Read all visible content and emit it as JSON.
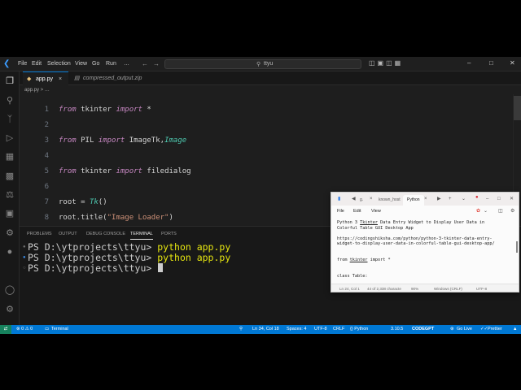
{
  "titlebar": {
    "menus": [
      "File",
      "Edit",
      "Selection",
      "View",
      "Go",
      "Run"
    ],
    "more": "…",
    "search_text": "ttyu"
  },
  "tabs": [
    {
      "label": "app.py",
      "close": "×"
    },
    {
      "label": "compressed_output.zip"
    }
  ],
  "breadcrumb": "app.py > …",
  "editor": {
    "lines": [
      {
        "n": "1",
        "parts": [
          [
            "kw it",
            "from"
          ],
          [
            "",
            " tkinter "
          ],
          [
            "kw it",
            "import"
          ],
          [
            "",
            " *"
          ]
        ]
      },
      {
        "n": "2",
        "parts": []
      },
      {
        "n": "3",
        "parts": [
          [
            "kw it",
            "from"
          ],
          [
            "",
            " PIL "
          ],
          [
            "kw it",
            "import"
          ],
          [
            "",
            " ImageTk,"
          ],
          [
            "cls it",
            "Image"
          ]
        ]
      },
      {
        "n": "4",
        "parts": []
      },
      {
        "n": "5",
        "parts": [
          [
            "kw it",
            "from"
          ],
          [
            "",
            " tkinter "
          ],
          [
            "kw it",
            "import"
          ],
          [
            "",
            " filedialog"
          ]
        ]
      },
      {
        "n": "6",
        "parts": []
      },
      {
        "n": "7",
        "parts": [
          [
            "",
            "root = "
          ],
          [
            "cls it",
            "Tk"
          ],
          [
            "",
            "()"
          ]
        ]
      },
      {
        "n": "8",
        "parts": [
          [
            "",
            "root.title("
          ],
          [
            "str",
            "\"Image Loader\""
          ],
          [
            "",
            ")"
          ]
        ]
      }
    ]
  },
  "panel": {
    "tabs": [
      "PROBLEMS",
      "OUTPUT",
      "DEBUG CONSOLE",
      "TERMINAL",
      "PORTS"
    ],
    "active_tab": "TERMINAL",
    "terminal": [
      {
        "prompt": "PS D:\\ytprojects\\ttyu> ",
        "cmd": "python app.py"
      },
      {
        "prompt": "PS D:\\ytprojects\\ttyu> ",
        "cmd": "python app.py"
      },
      {
        "prompt": "PS D:\\ytprojects\\ttyu> ",
        "cmd": ""
      }
    ]
  },
  "statusbar": {
    "errors": "⊗ 0 ⚠ 0",
    "terminal": "Terminal",
    "position": "Ln 34, Col 18",
    "spaces": "Spaces: 4",
    "encoding": "UTF-8",
    "eol": "CRLF",
    "language": "{} Python",
    "version": "3.10.5",
    "codegpt": "CODEGPT",
    "golive": "Go Live",
    "prettier": "Prettier"
  },
  "notepad": {
    "tabs": [
      "g.",
      "known_host",
      "Python"
    ],
    "menus": [
      "File",
      "Edit",
      "View"
    ],
    "lines": [
      {
        "text": "Python 3 ",
        "u": "Tkinter",
        "rest": " Data Entry Widget to Display User Data in"
      },
      {
        "text": "Colorful Table GUI Desktop App"
      },
      {
        "text": ""
      },
      {
        "text": "https://codingshiksha.com/python/python-3-tkinter-data-entry-"
      },
      {
        "text": "widget-to-display-user-data-in-colorful-table-gui-desktop-app/"
      },
      {
        "text": ""
      },
      {
        "text": ""
      },
      {
        "text": "from ",
        "u": "tkinter",
        "rest": " import *"
      },
      {
        "text": ""
      },
      {
        "text": ""
      },
      {
        "text": "class Table:"
      }
    ],
    "status": {
      "position": "Ln 24, Col 1",
      "chars": "44 of 2,338 characte",
      "zoom": "90%",
      "eol": "Windows (CRLF)",
      "encoding": "UTF-8"
    }
  }
}
